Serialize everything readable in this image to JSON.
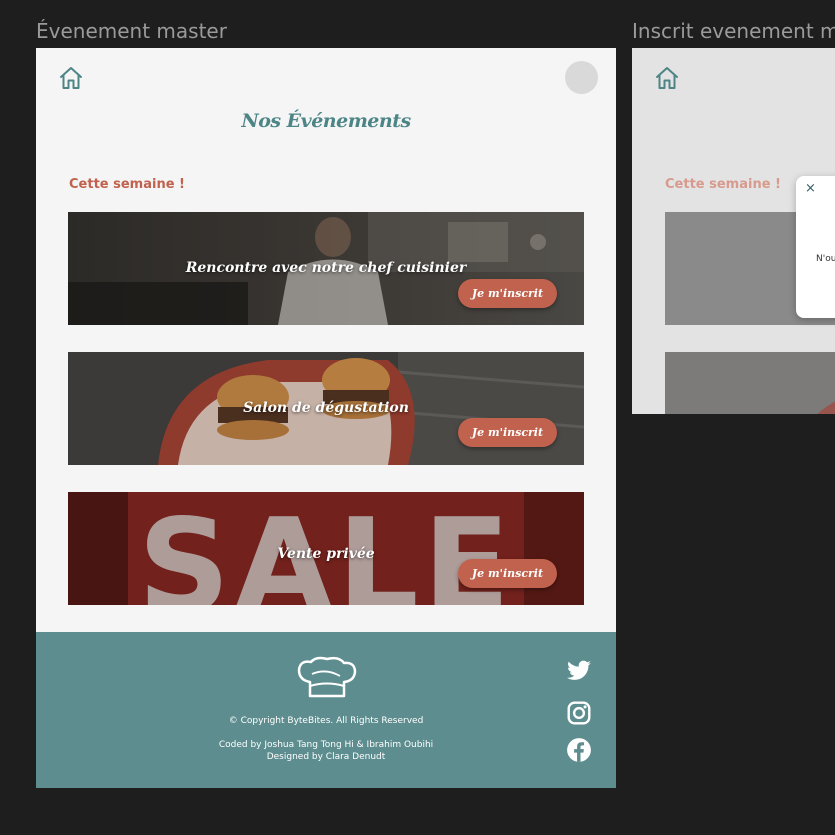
{
  "canvas": {
    "frame1_label": "Évenement master",
    "frame2_label": "Inscrit evenement m"
  },
  "header": {
    "home_icon": "home-icon",
    "avatar": "avatar-placeholder",
    "title": "Nos Événements"
  },
  "section": {
    "heading": "Cette semaine !"
  },
  "events": [
    {
      "title": "Rencontre avec notre chef cuisinier",
      "button": "Je m'inscrit",
      "image": "chef-cooking-photo"
    },
    {
      "title": "Salon de dégustation",
      "button": "Je m'inscrit",
      "image": "burgers-photo"
    },
    {
      "title": "Vente privée",
      "button": "Je m'inscrit",
      "image": "sale-sign-photo"
    }
  ],
  "footer": {
    "logo": "chef-hat-icon",
    "copyright": "© Copyright ByteBites. All Rights Reserved",
    "coded_by": "Coded by Joshua Tang Tong Hi & Ibrahim Oubihi",
    "designed_by": "Designed by Clara Denudt",
    "social": [
      "twitter-icon",
      "instagram-icon",
      "facebook-icon"
    ]
  },
  "frame2": {
    "heading": "Cette semaine !",
    "modal_close": "×",
    "modal_text": "N'ou"
  },
  "colors": {
    "accent": "#c0624e",
    "title_teal": "#4d8587",
    "footer_bg": "#5e8d8f",
    "page_bg": "#f5f5f5",
    "canvas_bg": "#1e1e1e"
  }
}
